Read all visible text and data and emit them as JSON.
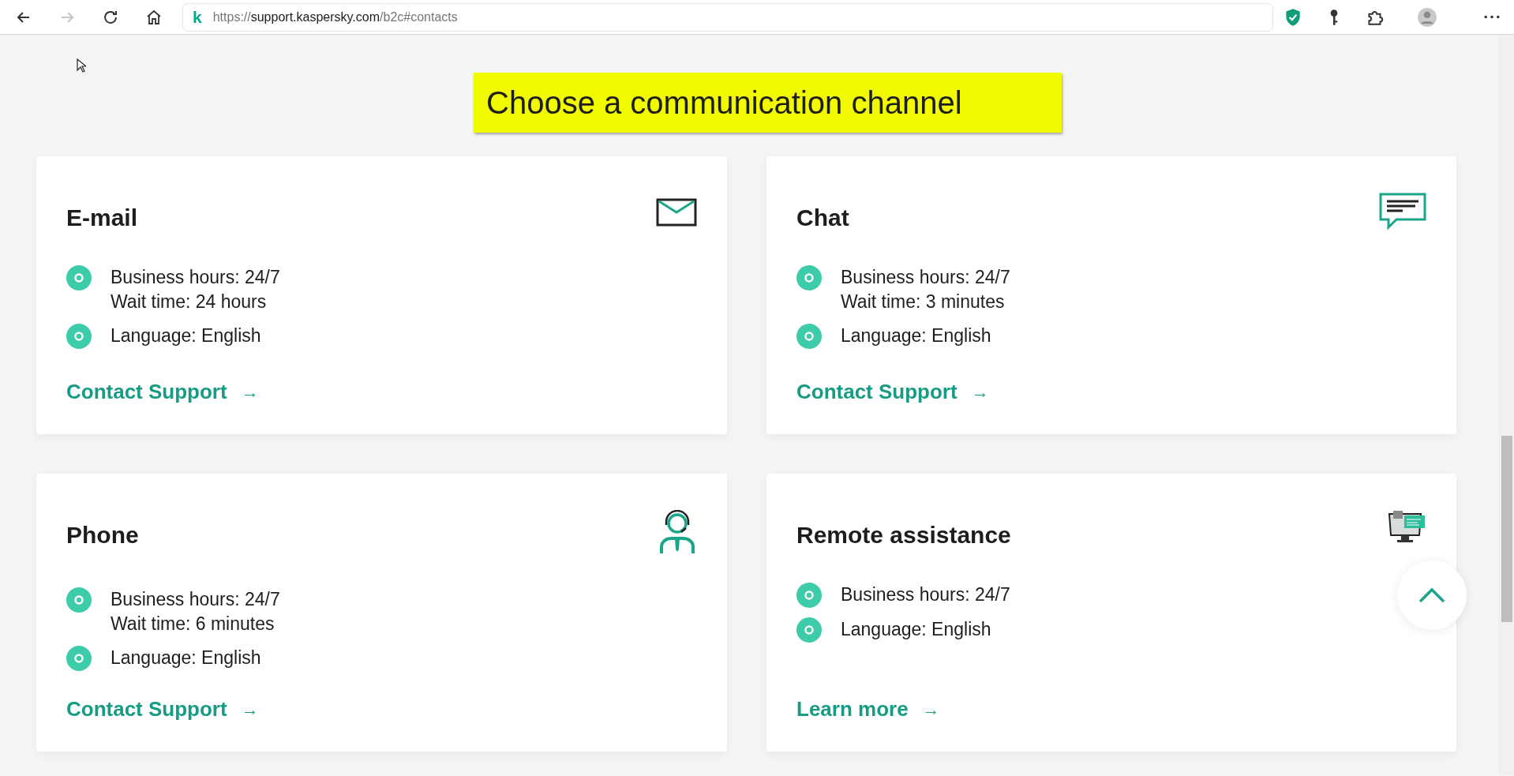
{
  "browser": {
    "nav_buttons": [
      {
        "kind": "back",
        "disabled": false
      },
      {
        "kind": "forward",
        "disabled": true
      },
      {
        "kind": "reload",
        "disabled": false
      },
      {
        "kind": "home",
        "disabled": false
      }
    ],
    "address": {
      "site_logo": "k",
      "scheme": "https://",
      "host": "support.kaspersky.com",
      "path": "/b2c#contacts"
    },
    "toolbar_icons": [
      {
        "kind": "shield"
      },
      {
        "kind": "key"
      },
      {
        "kind": "puzzle"
      },
      {
        "kind": "avatar"
      },
      {
        "kind": "more"
      }
    ]
  },
  "heading": "Choose a communication channel",
  "cards": [
    {
      "title": "E-mail",
      "kind": "envelope",
      "items": [
        {
          "lines": [
            "Business hours: 24/7",
            "Wait time: 24 hours"
          ]
        },
        {
          "lines": [
            "Language: English"
          ]
        }
      ],
      "link": {
        "label": "Contact Support",
        "arrow": "→"
      }
    },
    {
      "title": "Chat",
      "kind": "chat",
      "items": [
        {
          "lines": [
            "Business hours: 24/7",
            "Wait time: 3 minutes"
          ]
        },
        {
          "lines": [
            "Language: English"
          ]
        }
      ],
      "link": {
        "label": "Contact Support",
        "arrow": "→"
      }
    },
    {
      "title": "Phone",
      "kind": "headset",
      "items": [
        {
          "lines": [
            "Business hours: 24/7",
            "Wait time: 6 minutes"
          ]
        },
        {
          "lines": [
            "Language: English"
          ]
        }
      ],
      "link": {
        "label": "Contact Support",
        "arrow": "→"
      }
    },
    {
      "title": "Remote assistance",
      "kind": "remote",
      "items": [
        {
          "lines": [
            "Business hours: 24/7"
          ]
        },
        {
          "lines": [
            "Language: English"
          ]
        }
      ],
      "link": {
        "label": "Learn more",
        "arrow": "→"
      }
    }
  ]
}
